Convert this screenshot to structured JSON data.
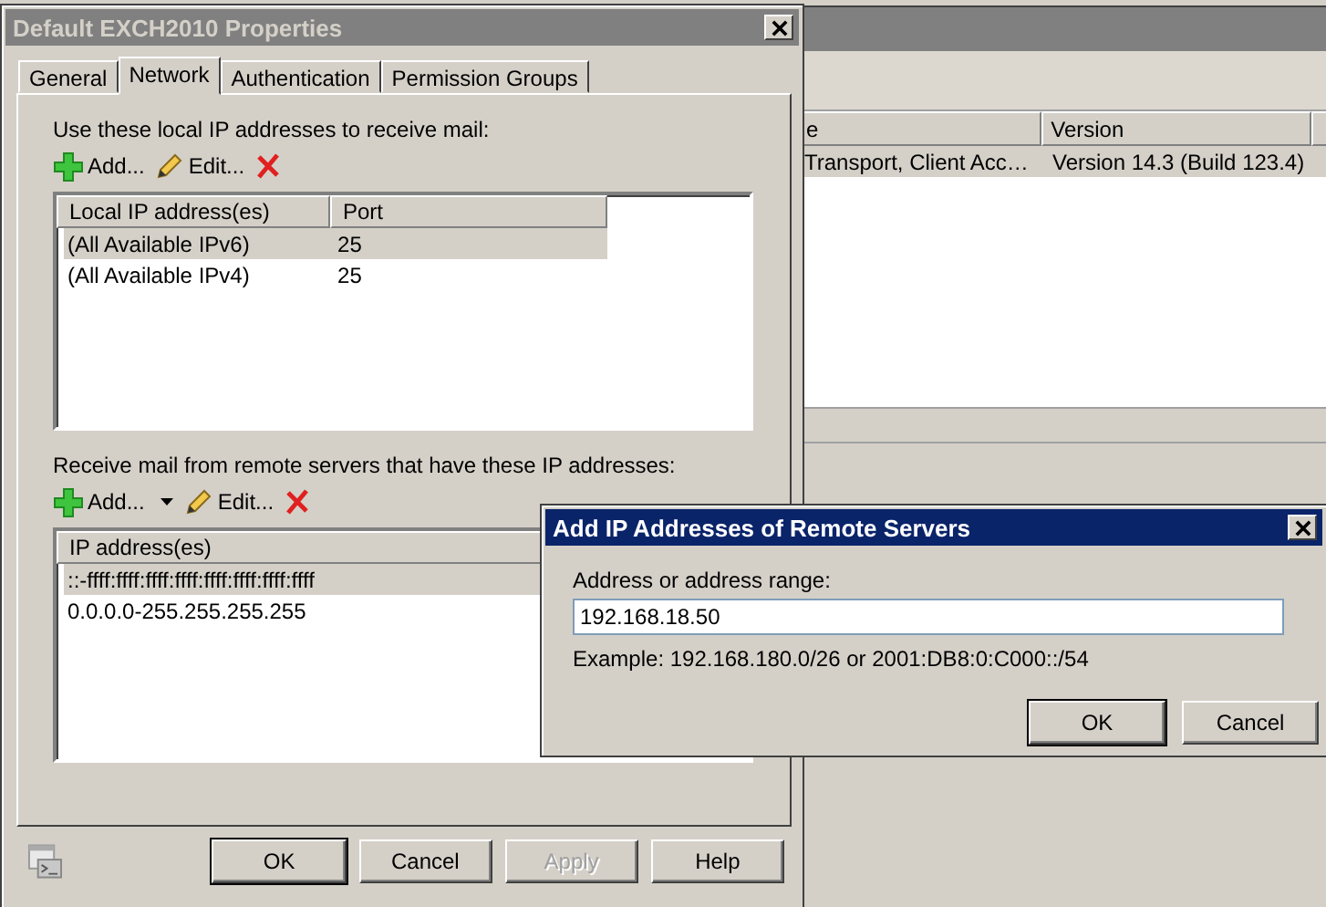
{
  "background_window": {
    "columns": [
      {
        "label": "e"
      },
      {
        "label": "Version"
      }
    ],
    "rows": [
      {
        "cells": [
          "Transport, Client Acc…",
          "Version 14.3 (Build 123.4)"
        ],
        "selected": true
      }
    ]
  },
  "properties_dialog": {
    "title": "Default EXCH2010 Properties",
    "active": false,
    "tabs": [
      {
        "label": "General",
        "selected": false
      },
      {
        "label": "Network",
        "selected": true
      },
      {
        "label": "Authentication",
        "selected": false
      },
      {
        "label": "Permission Groups",
        "selected": false
      }
    ],
    "sections": [
      {
        "label": "Use these local IP addresses to receive mail:",
        "toolbar": [
          {
            "kind": "add",
            "label": "Add..."
          },
          {
            "kind": "edit",
            "label": "Edit..."
          },
          {
            "kind": "remove"
          }
        ],
        "columns": [
          {
            "label": "Local IP address(es)"
          },
          {
            "label": "Port"
          }
        ],
        "rows": [
          {
            "cells": [
              "(All Available IPv6)",
              "25"
            ],
            "selected": true
          },
          {
            "cells": [
              "(All Available IPv4)",
              "25"
            ],
            "selected": false
          }
        ]
      },
      {
        "label": "Receive mail from remote servers that have these IP addresses:",
        "toolbar": [
          {
            "kind": "add-menu",
            "label": "Add..."
          },
          {
            "kind": "edit",
            "label": "Edit..."
          },
          {
            "kind": "remove"
          }
        ],
        "columns": [
          {
            "label": "IP address(es)"
          }
        ],
        "rows": [
          {
            "cells": [
              "::-ffff:ffff:ffff:ffff:ffff:ffff:ffff:ffff"
            ],
            "selected": true
          },
          {
            "cells": [
              "0.0.0.0-255.255.255.255"
            ],
            "selected": false
          }
        ]
      }
    ],
    "buttons": [
      {
        "label": "OK",
        "default": true,
        "disabled": false
      },
      {
        "label": "Cancel",
        "default": false,
        "disabled": false
      },
      {
        "label": "Apply",
        "default": false,
        "disabled": true
      },
      {
        "label": "Help",
        "default": false,
        "disabled": false
      }
    ]
  },
  "add_dialog": {
    "title": "Add IP Addresses of Remote Servers",
    "active": true,
    "label": "Address or address range:",
    "value": "192.168.18.50",
    "example": "Example: 192.168.180.0/26 or 2001:DB8:0:C000::/54",
    "buttons": [
      {
        "label": "OK",
        "default": true,
        "disabled": false
      },
      {
        "label": "Cancel",
        "default": false,
        "disabled": false
      }
    ]
  }
}
